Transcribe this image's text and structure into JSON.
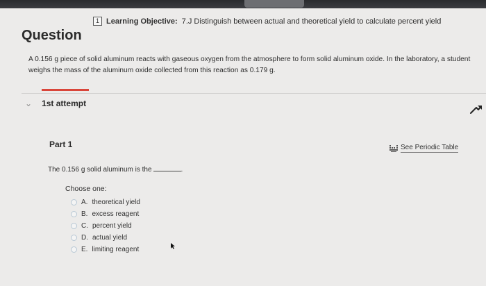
{
  "objective": {
    "number": "1",
    "label": "Learning Objective:",
    "text": "7.J Distinguish between actual and theoretical yield to calculate percent yield"
  },
  "question": {
    "title": "Question",
    "body": "A 0.156 g piece of solid aluminum reacts with gaseous oxygen from the atmosphere to form solid aluminum oxide. In the laboratory, a student weighs the mass of the aluminum oxide collected from this reaction as 0.179 g."
  },
  "attempt": {
    "label": "1st attempt",
    "chevron_icon": "chevron-down-icon",
    "collapse_icon": "arrow-up-icon"
  },
  "part": {
    "label": "Part 1",
    "periodic_table_link": "See Periodic Table",
    "periodic_icon": "periodic-table-icon",
    "stem": "The 0.156 g solid aluminum is the",
    "stem_end": ".",
    "choose_label": "Choose one:",
    "options": [
      {
        "letter": "A.",
        "text": "theoretical yield"
      },
      {
        "letter": "B.",
        "text": "excess reagent"
      },
      {
        "letter": "C.",
        "text": "percent yield"
      },
      {
        "letter": "D.",
        "text": "actual yield"
      },
      {
        "letter": "E.",
        "text": "limiting reagent"
      }
    ]
  },
  "colors": {
    "background": "#ecebea",
    "accent_red": "#d9453a",
    "text": "#2b2b2b"
  }
}
